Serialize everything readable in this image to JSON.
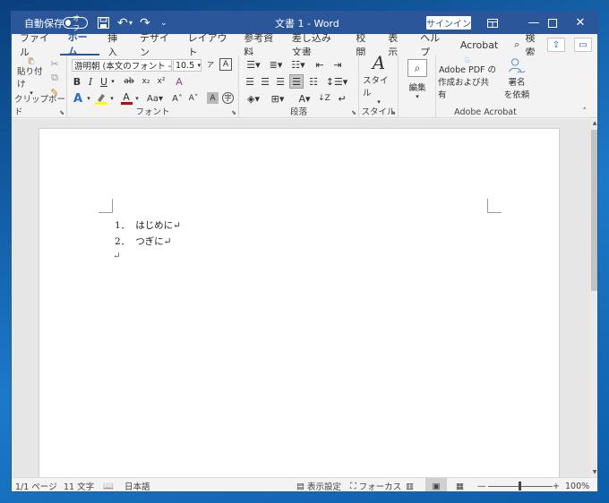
{
  "titlebar": {
    "autosave_label": "自動保存",
    "autosave_state": "オフ",
    "doc_title": "文書 1  -  Word",
    "signin_label": "サインイン"
  },
  "tabs": [
    "ファイル",
    "ホーム",
    "挿入",
    "デザイン",
    "レイアウト",
    "参考資料",
    "差し込み文書",
    "校閲",
    "表示",
    "ヘルプ",
    "Acrobat",
    "検索"
  ],
  "ribbon": {
    "paste_label": "貼り付け",
    "clipboard_label": "クリップボード",
    "font_name": "游明朝 (本文のフォント - 日:",
    "font_size": "10.5",
    "font_label": "フォント",
    "paragraph_label": "段落",
    "style_btn_label": "スタイル",
    "style_label": "スタイル",
    "edit_label": "編集",
    "acrobat_pdf_label_1": "Adobe PDF の",
    "acrobat_pdf_label_2": "作成および共有",
    "acrobat_sign_label_1": "署名",
    "acrobat_sign_label_2": "を依頼",
    "acrobat_group_label": "Adobe Acrobat"
  },
  "document": {
    "lines": [
      {
        "num": "1．",
        "text": "はじめに↵"
      },
      {
        "num": "2．",
        "text": "つぎに↵"
      },
      {
        "num": "",
        "text": "↵"
      }
    ]
  },
  "status": {
    "page": "1/1 ページ",
    "words": "11 文字",
    "language": "日本語",
    "display_settings": "表示設定",
    "focus": "フォーカス",
    "zoom": "100%",
    "zoom_level": 1.0
  },
  "colors": {
    "accent": "#2b579a",
    "highlight": "#ffff00",
    "font_color": "#d00000"
  }
}
